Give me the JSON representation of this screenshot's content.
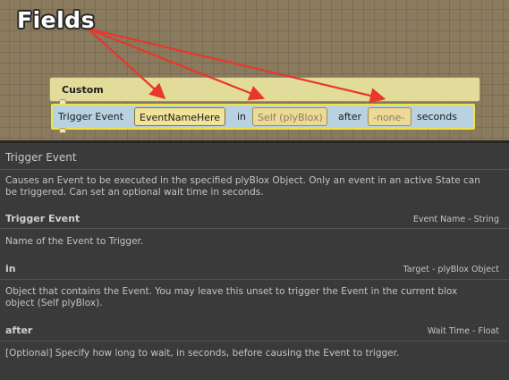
{
  "annotation": {
    "label": "Fields",
    "arrow_color": "#e8372b"
  },
  "block": {
    "header": "Custom",
    "part1": "Trigger Event",
    "event_field": "EventNameHere",
    "part2": "in",
    "target_field": "Self (plyBlox)",
    "part3": "after",
    "wait_field": "-none-",
    "part4": "seconds"
  },
  "doc": {
    "title": "Trigger Event",
    "description": "Causes an Event to be executed in the specified plyBlox Object. Only an event in an active State can be triggered. Can set an optional wait time in seconds.",
    "sections": [
      {
        "name": "Trigger Event",
        "type": "Event Name - String",
        "description": "Name of the Event to Trigger."
      },
      {
        "name": "in",
        "type": "Target - plyBlox Object",
        "description": "Object that contains the Event. You may leave this unset to trigger the Event in the current blox object (Self plyBlox)."
      },
      {
        "name": "after",
        "type": "Wait Time - Float",
        "description": "[Optional] Specify how long to wait, in seconds, before causing the Event to trigger."
      }
    ]
  }
}
